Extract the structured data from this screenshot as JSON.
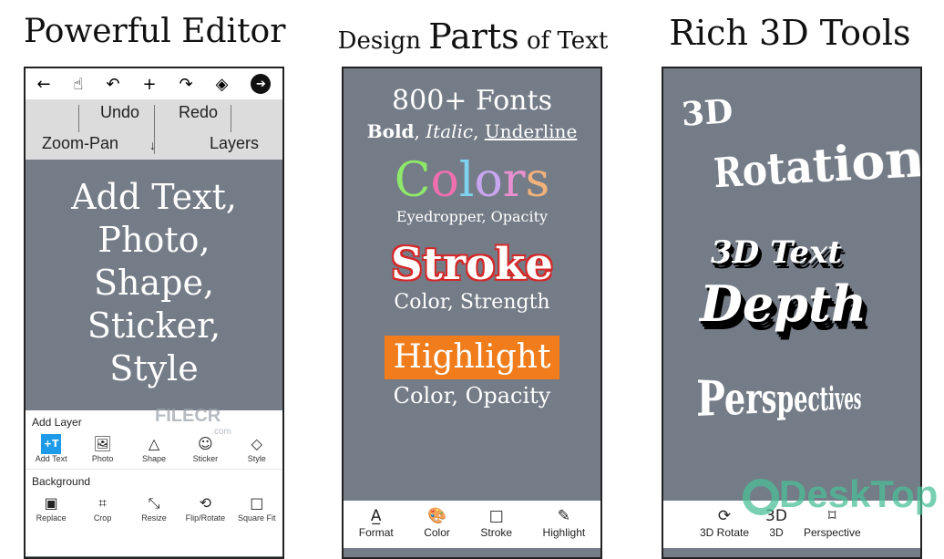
{
  "titles": {
    "left": "Powerful Editor",
    "middle_prefix": "Design",
    "middle_big": "Parts",
    "middle_suffix": "of Text",
    "right": "Rich 3D Tools"
  },
  "left": {
    "toolbar": [
      {
        "icon": "back-arrow-icon",
        "glyph": "←"
      },
      {
        "icon": "hand-pan-icon",
        "glyph": "☝"
      },
      {
        "icon": "undo-icon",
        "glyph": "↶"
      },
      {
        "icon": "add-icon",
        "glyph": "+"
      },
      {
        "icon": "redo-icon",
        "glyph": "↷"
      },
      {
        "icon": "layers-icon",
        "glyph": "◈"
      },
      {
        "icon": "next-icon",
        "glyph": "➔"
      }
    ],
    "guide": {
      "undo": "Undo",
      "redo": "Redo",
      "zoom_pan": "Zoom-Pan",
      "layers": "Layers"
    },
    "headline": [
      "Add Text,",
      "Photo,",
      "Shape,",
      "Sticker,",
      "Style"
    ],
    "add_layer": {
      "label": "Add Layer",
      "items": [
        {
          "label": "Add Text",
          "glyph": "+T"
        },
        {
          "label": "Photo",
          "glyph": "🖼"
        },
        {
          "label": "Shape",
          "glyph": "△"
        },
        {
          "label": "Sticker",
          "glyph": "☺"
        },
        {
          "label": "Style",
          "glyph": "◇"
        }
      ]
    },
    "background": {
      "label": "Background",
      "items": [
        {
          "label": "Replace",
          "glyph": "▣"
        },
        {
          "label": "Crop",
          "glyph": "⌗"
        },
        {
          "label": "Resize",
          "glyph": "⤡"
        },
        {
          "label": "Flip/Rotate",
          "glyph": "⟲"
        },
        {
          "label": "Square Fit",
          "glyph": "□"
        }
      ]
    }
  },
  "middle": {
    "fonts": "800+ Fonts",
    "styles": {
      "bold": "Bold",
      "italic": "Italic",
      "underline": "Underline"
    },
    "colors": "Colors",
    "colors_letters": [
      "C",
      "o",
      "l",
      "o",
      "r",
      "s"
    ],
    "color_palette": [
      "#8ee86a",
      "#f06fae",
      "#7fd3f0",
      "#c9a6f0",
      "#e890d0",
      "#f0b27a"
    ],
    "colors_sub": "Eyedropper, Opacity",
    "stroke": "Stroke",
    "stroke_color": "#d62828",
    "stroke_sub": "Color, Strength",
    "highlight": "Highlight",
    "highlight_color": "#f07c1c",
    "highlight_sub": "Color, Opacity",
    "bottom": [
      {
        "label": "Format",
        "glyph": "A̲"
      },
      {
        "label": "Color",
        "glyph": "🎨"
      },
      {
        "label": "Stroke",
        "glyph": "□"
      },
      {
        "label": "Highlight",
        "glyph": "✎"
      }
    ]
  },
  "right": {
    "rot_3d": "3D",
    "rotation": "Rotation",
    "text_3d": "3D Text",
    "depth": "Depth",
    "perspectives": "Perspectives",
    "bottom": [
      {
        "label": "3D Rotate",
        "glyph": "⟳"
      },
      {
        "label": "3D",
        "glyph": "3D"
      },
      {
        "label": "Perspective",
        "glyph": "⌑"
      }
    ]
  },
  "watermarks": {
    "filecr": "FILECR",
    "filecr_com": ".com",
    "desktop": "DeskTop"
  }
}
